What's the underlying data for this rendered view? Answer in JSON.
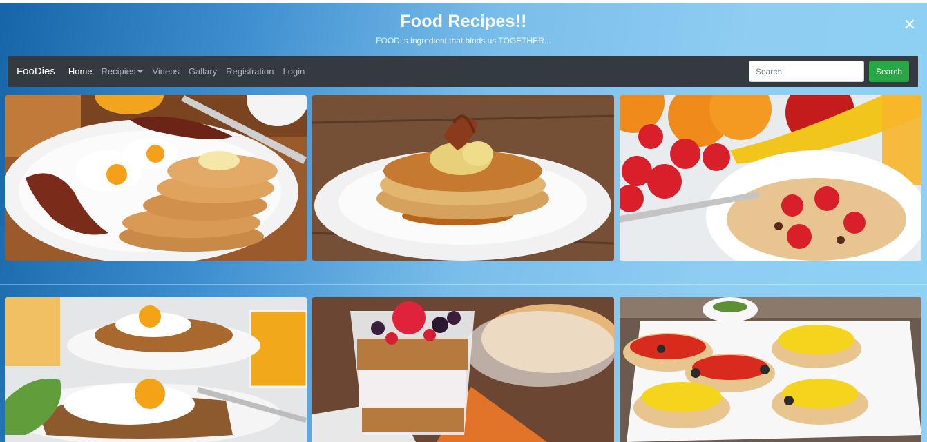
{
  "header": {
    "title": "Food Recipes!!",
    "subtitle": "FOOD is ingredient that binds us TOGETHER...",
    "close_icon": "close-icon"
  },
  "navbar": {
    "brand": "FooDies",
    "links": [
      {
        "label": "Home",
        "active": true
      },
      {
        "label": "Recipies",
        "dropdown": true
      },
      {
        "label": "Videos"
      },
      {
        "label": "Gallary"
      },
      {
        "label": "Registration"
      },
      {
        "label": "Login"
      }
    ],
    "search": {
      "placeholder": "Search",
      "value": "",
      "button_label": "Search"
    }
  },
  "gallery": [
    {
      "name": "pancakes-bacon-eggs-image"
    },
    {
      "name": "pancakes-syrup-banana-image"
    },
    {
      "name": "granola-strawberries-image"
    },
    {
      "name": "eggs-toast-orange-juice-image"
    },
    {
      "name": "yogurt-parfait-berries-image"
    },
    {
      "name": "mini-breakfast-pizzas-image"
    }
  ],
  "colors": {
    "navbar": "#343a40",
    "search_button": "#28a745",
    "background_left": "#1565a8",
    "background_right": "#8ed2f5"
  }
}
